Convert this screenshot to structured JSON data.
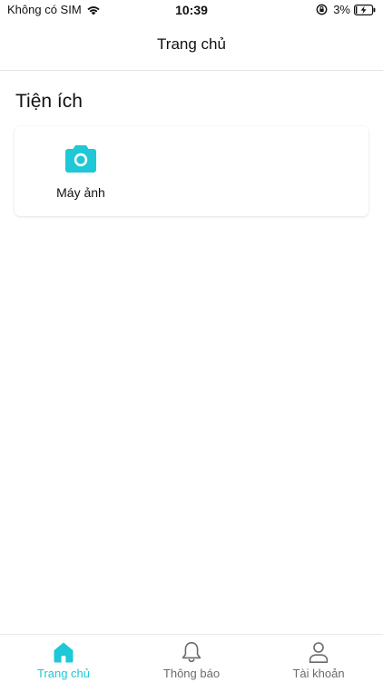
{
  "status_bar": {
    "carrier": "Không có SIM",
    "time": "10:39",
    "battery": "3%"
  },
  "header": {
    "title": "Trang chủ"
  },
  "section": {
    "title": "Tiện ích",
    "items": [
      {
        "label": "Máy ảnh",
        "icon": "camera-icon"
      }
    ]
  },
  "tab_bar": {
    "tabs": [
      {
        "label": "Trang chủ",
        "icon": "home-icon",
        "active": true
      },
      {
        "label": "Thông báo",
        "icon": "bell-icon",
        "active": false
      },
      {
        "label": "Tài khoản",
        "icon": "user-icon",
        "active": false
      }
    ]
  },
  "colors": {
    "accent": "#1ec8d6",
    "inactive": "#6b6b6b",
    "text": "#111111"
  }
}
